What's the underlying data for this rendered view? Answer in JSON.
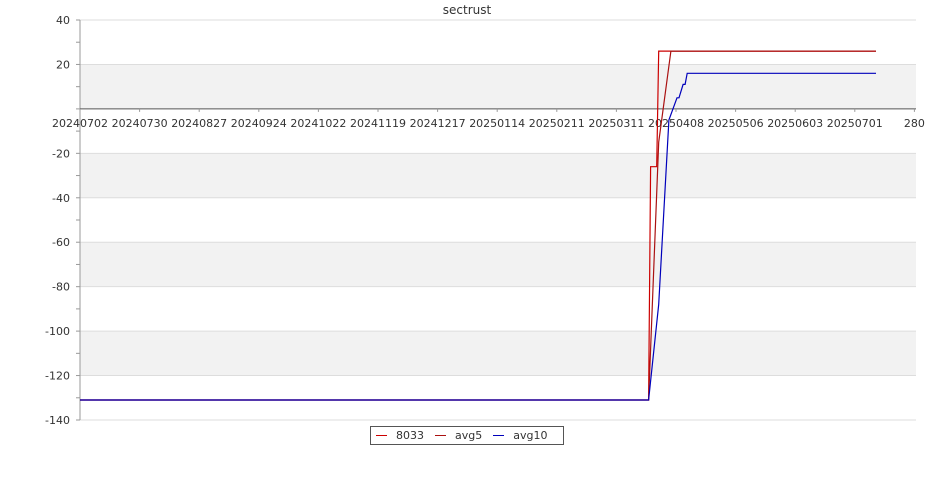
{
  "chart_data": {
    "type": "line",
    "title": "sectrust",
    "xlabel": "",
    "ylabel": "",
    "ylim": [
      -140,
      40
    ],
    "y_ticks": [
      40,
      20,
      -20,
      -40,
      -60,
      -80,
      -100,
      -120,
      -140
    ],
    "x_tick_labels": [
      "20240702",
      "20240730",
      "20240827",
      "20240924",
      "20241022",
      "20241119",
      "20241217",
      "20250114",
      "20250211",
      "20250311",
      "20250408",
      "20250506",
      "20250603",
      "20250701",
      "280"
    ],
    "grid": true,
    "legend_position": "bottom-center",
    "x_range_days": [
      0,
      392
    ],
    "series": [
      {
        "name": "8033",
        "color": "#cc0000",
        "x_days": [
          0,
          280,
          281,
          284,
          285,
          392
        ],
        "values": [
          -131,
          -131,
          -26,
          -26,
          26,
          26
        ]
      },
      {
        "name": "avg5",
        "color": "#aa1111",
        "x_days": [
          0,
          280,
          285,
          291,
          392
        ],
        "values": [
          -131,
          -131,
          -15,
          26,
          26
        ]
      },
      {
        "name": "avg10",
        "color": "#0000bb",
        "x_days": [
          0,
          280,
          285,
          290,
          294,
          295,
          297,
          298,
          299,
          300,
          392
        ],
        "values": [
          -131,
          -131,
          -88,
          -5,
          5,
          5,
          11,
          11,
          16,
          16,
          16
        ]
      }
    ]
  }
}
